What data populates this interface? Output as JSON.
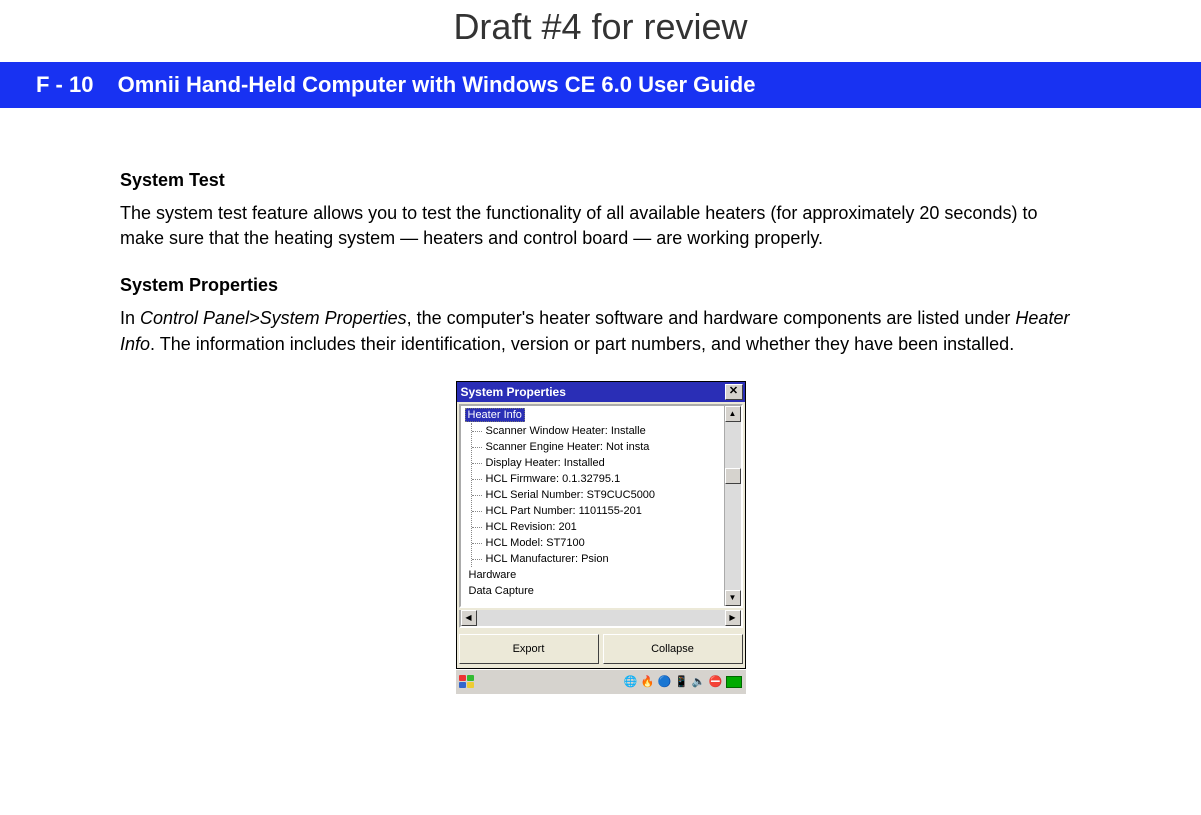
{
  "draft_title": "Draft #4 for review",
  "banner": {
    "page_number": "F - 10",
    "title": "Omnii Hand-Held Computer with Windows CE 6.0 User Guide"
  },
  "sections": [
    {
      "heading": "System Test",
      "body_plain": "The system test feature allows you to test the functionality of all available heaters (for approximately 20 seconds) to make sure that the heating system — heaters and control board — are working properly."
    },
    {
      "heading": "System Properties",
      "body_pre": "In ",
      "body_ital1": "Control Panel>System Properties",
      "body_mid": ", the computer's heater software and hardware components are listed under ",
      "body_ital2": "Heater Info",
      "body_post": ". The information includes their identification, version or part numbers, and whether they have been installed."
    }
  ],
  "dialog": {
    "title": "System Properties",
    "tree_root": "Heater Info",
    "tree_items": [
      "Scanner Window Heater: Installe",
      "Scanner Engine Heater: Not insta",
      "Display Heater: Installed",
      "HCL Firmware: 0.1.32795.1",
      "HCL Serial Number: ST9CUC5000",
      "HCL Part Number: 1101155-201",
      "HCL Revision: 201",
      "HCL Model: ST7100",
      "HCL Manufacturer: Psion"
    ],
    "tree_bottom": [
      "Hardware",
      "Data Capture"
    ],
    "buttons": {
      "export": "Export",
      "collapse": "Collapse"
    }
  }
}
